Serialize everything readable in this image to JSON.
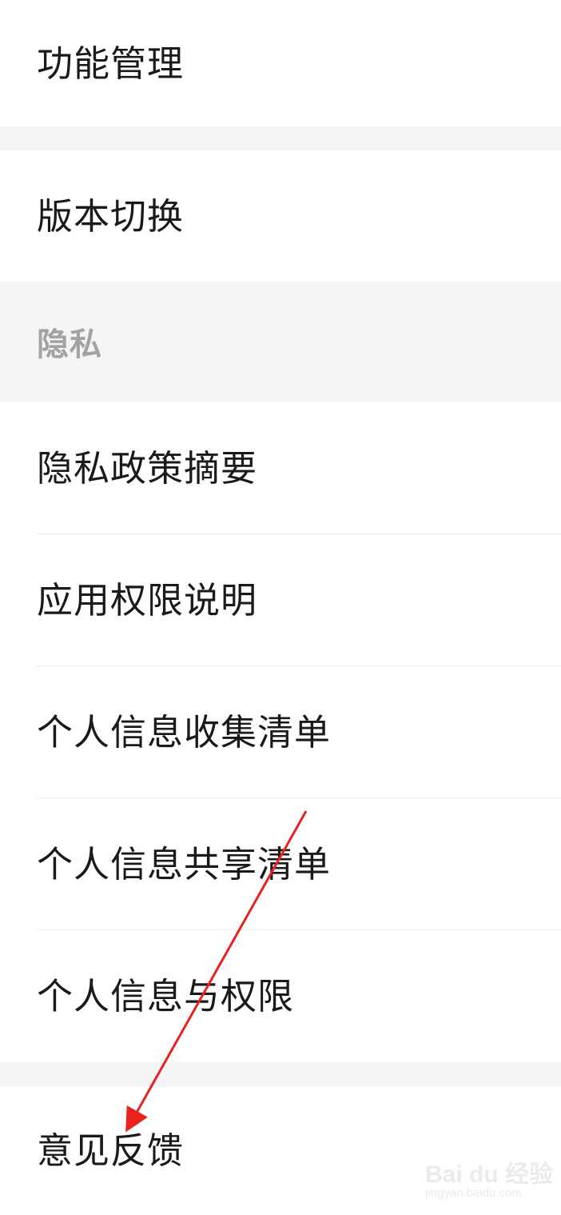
{
  "settings": {
    "rows_top": [
      {
        "label": "功能管理"
      },
      {
        "label": "版本切换"
      }
    ],
    "privacy_section": {
      "title": "隐私",
      "items": [
        {
          "label": "隐私政策摘要"
        },
        {
          "label": "应用权限说明"
        },
        {
          "label": "个人信息收集清单"
        },
        {
          "label": "个人信息共享清单"
        },
        {
          "label": "个人信息与权限"
        }
      ]
    },
    "rows_bottom": [
      {
        "label": "意见反馈"
      }
    ]
  },
  "annotation": {
    "arrow_color": "#e8231e"
  },
  "watermark": {
    "logo_text": "Bai du 经验",
    "url_text": "jingyan.baidu.com"
  },
  "colors": {
    "background": "#ffffff",
    "section_gap": "#f5f5f5",
    "section_title": "#a3a3a3",
    "text": "#1a1a1a",
    "divider": "#ececec"
  }
}
